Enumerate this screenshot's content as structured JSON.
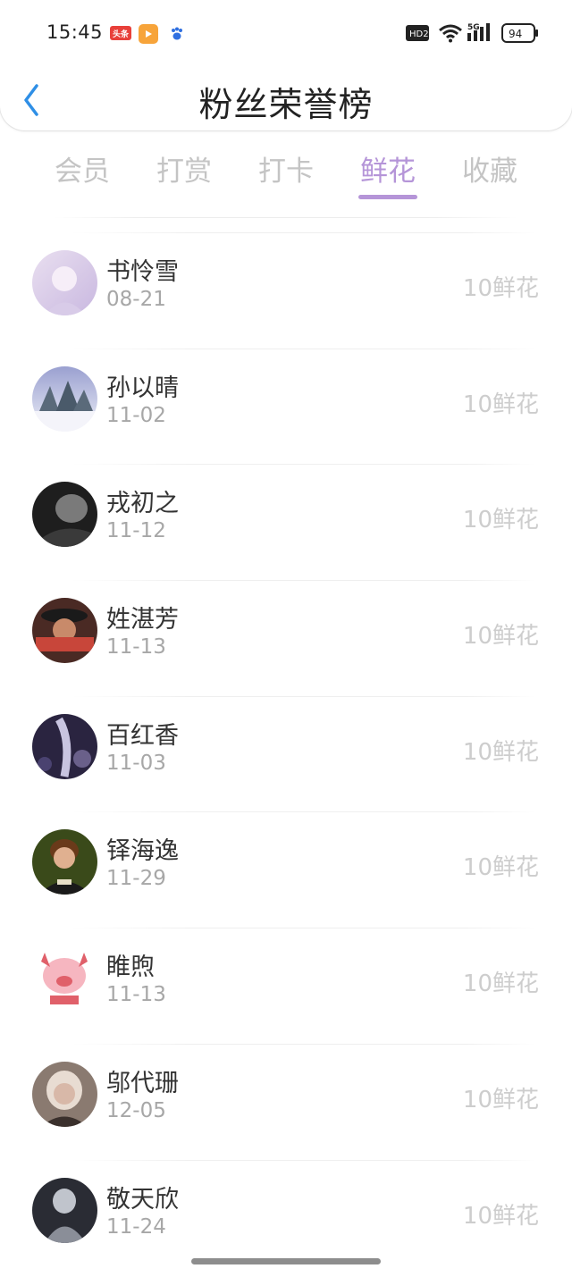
{
  "status_bar": {
    "time": "15:45",
    "app_icon_1_text": "头条",
    "network_badge": "HD2",
    "cell_label": "5G",
    "battery": "94",
    "colors": {
      "toutiao": "#e8403a",
      "video_app": "#f7a43a",
      "baidu": "#2f6fe0"
    }
  },
  "header": {
    "title": "粉丝荣誉榜",
    "back_icon": "chevron-left-icon",
    "accent_color": "#2f8fe6"
  },
  "tabs": {
    "items": [
      {
        "label": "会员"
      },
      {
        "label": "打赏"
      },
      {
        "label": "打卡"
      },
      {
        "label": "鲜花"
      },
      {
        "label": "收藏"
      }
    ],
    "active": "鲜花",
    "active_color": "#b595d8"
  },
  "fans": [
    {
      "name": "书怜雪",
      "date": "08-21",
      "amount": "10鲜花",
      "avatar_colors": [
        "#e9dff0",
        "#c9b8e0"
      ]
    },
    {
      "name": "孙以晴",
      "date": "11-02",
      "amount": "10鲜花",
      "avatar_colors": [
        "#9aa0d0",
        "#eef0f8"
      ]
    },
    {
      "name": "戎初之",
      "date": "11-12",
      "amount": "10鲜花",
      "avatar_colors": [
        "#2a2a2a",
        "#8a8a8a"
      ]
    },
    {
      "name": "姓湛芳",
      "date": "11-13",
      "amount": "10鲜花",
      "avatar_colors": [
        "#4a2a24",
        "#c8463a"
      ]
    },
    {
      "name": "百红香",
      "date": "11-03",
      "amount": "10鲜花",
      "avatar_colors": [
        "#2a2440",
        "#9a90c8"
      ]
    },
    {
      "name": "铎海逸",
      "date": "11-29",
      "amount": "10鲜花",
      "avatar_colors": [
        "#3a4a1a",
        "#d8b08a"
      ]
    },
    {
      "name": "睢煦",
      "date": "11-13",
      "amount": "10鲜花",
      "avatar_colors": [
        "#f6c6d0",
        "#e0606a"
      ]
    },
    {
      "name": "邬代珊",
      "date": "12-05",
      "amount": "10鲜花",
      "avatar_colors": [
        "#6a5a52",
        "#e8dcd2"
      ]
    },
    {
      "name": "敬天欣",
      "date": "11-24",
      "amount": "10鲜花",
      "avatar_colors": [
        "#2a2c34",
        "#c0c4cc"
      ]
    }
  ]
}
